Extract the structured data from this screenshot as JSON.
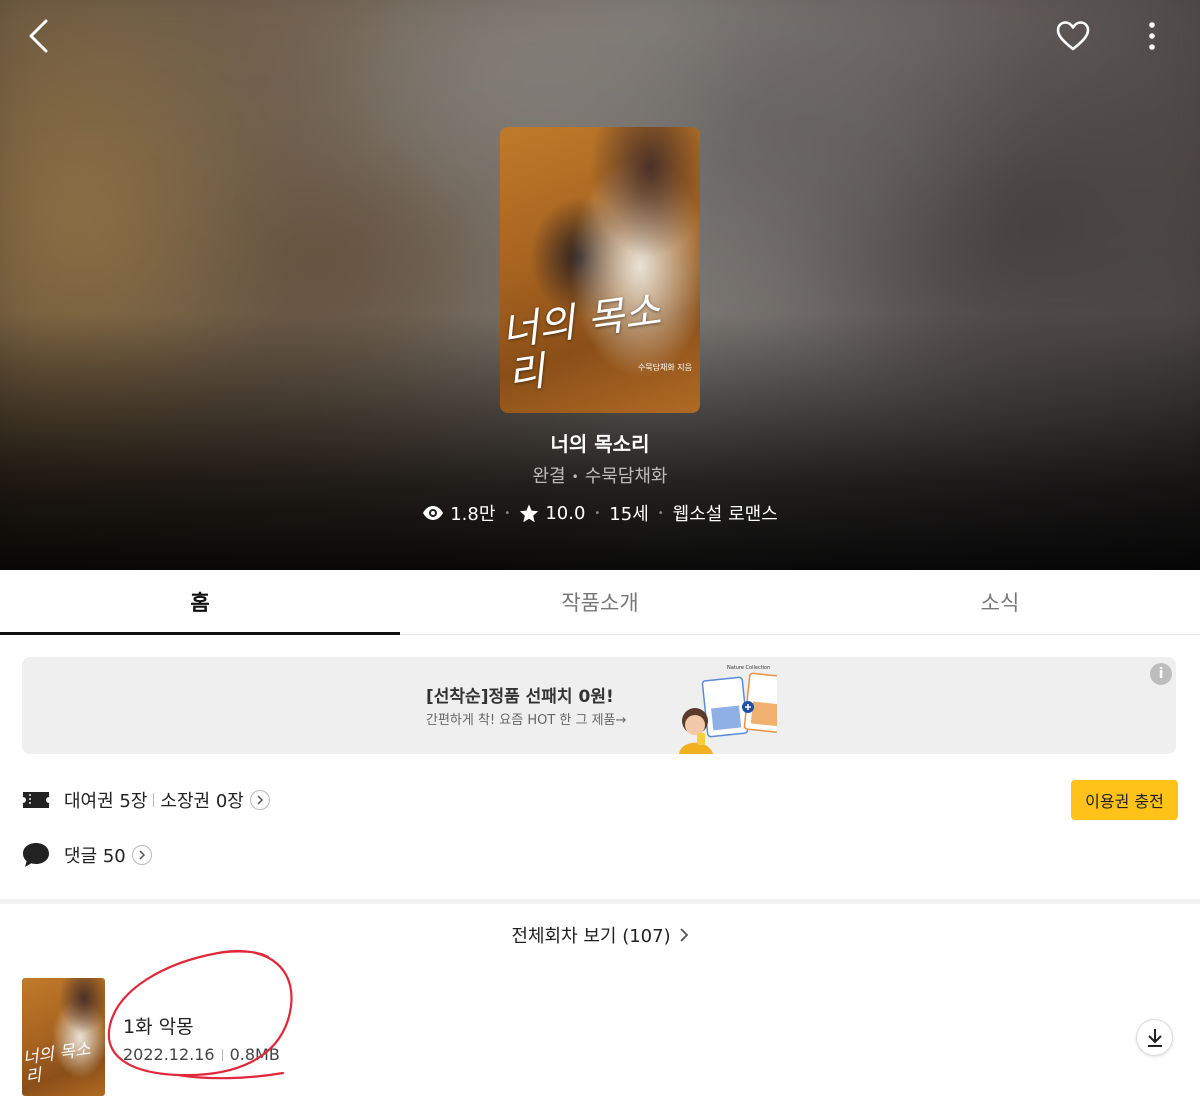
{
  "colors": {
    "accent_yellow": "#ffc21a",
    "annotation_red": "#e0283a",
    "tab_active": "#111111"
  },
  "header": {
    "icons": [
      "back-icon",
      "heart-icon",
      "more-vertical-icon"
    ]
  },
  "work": {
    "cover_title": "너의 목소리",
    "cover_author": "수묵담채화 지음",
    "title": "너의 목소리",
    "status": "완결",
    "author": "수묵담채화",
    "views": "1.8만",
    "rating": "10.0",
    "age_rating": "15세",
    "genre": "웹소설 로맨스"
  },
  "tabs": [
    {
      "label": "홈",
      "active": true
    },
    {
      "label": "작품소개",
      "active": false
    },
    {
      "label": "소식",
      "active": false
    }
  ],
  "ad": {
    "title": "[선착순]정품 선패치 0원!",
    "description": "간편하게 착! 요즘 HOT 한 그 제품→",
    "brand": "Nature Collection",
    "info_label": "i"
  },
  "tickets": {
    "rental": "대여권 5장",
    "owned": "소장권 0장",
    "charge_label": "이용권 충전"
  },
  "comments": {
    "label": "댓글 50"
  },
  "episodes_link": {
    "label": "전체회차 보기 (107)"
  },
  "episode": {
    "title": "1화 악몽",
    "date": "2022.12.16",
    "size": "0.8MB",
    "thumb_title": "너의 목소리"
  }
}
